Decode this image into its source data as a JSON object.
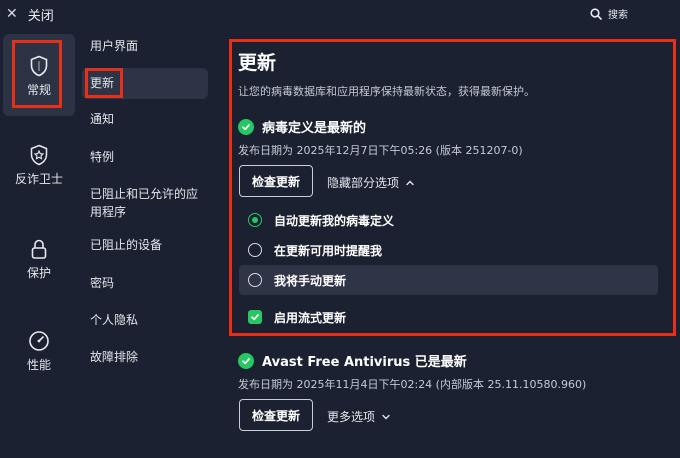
{
  "window": {
    "close_label": "关闭",
    "search_label": "搜索"
  },
  "iconbar": [
    {
      "label": "常规",
      "icon": "shield-icon",
      "active": true
    },
    {
      "label": "反诈卫士",
      "icon": "shield-star-icon"
    },
    {
      "label": "保护",
      "icon": "lock-icon"
    },
    {
      "label": "性能",
      "icon": "speedometer-icon"
    }
  ],
  "submenu": [
    {
      "label": "用户界面"
    },
    {
      "label": "更新",
      "active": true
    },
    {
      "label": "通知"
    },
    {
      "label": "特例"
    },
    {
      "label": "已阻止和已允许的应用程序"
    },
    {
      "label": "已阻止的设备"
    },
    {
      "label": "密码"
    },
    {
      "label": "个人隐私"
    },
    {
      "label": "故障排除"
    }
  ],
  "content": {
    "title": "更新",
    "description": "让您的病毒数据库和应用程序保持最新状态，获得最新保护。",
    "virus_defs": {
      "status": "病毒定义是最新的",
      "meta": "发布日期为 2025年12月7日下午05:26 (版本 251207-0)",
      "check_button": "检查更新",
      "toggle_link": "隐藏部分选项",
      "options": [
        {
          "label": "自动更新我的病毒定义",
          "checked": true
        },
        {
          "label": "在更新可用时提醒我",
          "checked": false
        },
        {
          "label": "我将手动更新",
          "checked": false
        }
      ],
      "streaming_label": "启用流式更新",
      "streaming_checked": true
    },
    "app": {
      "status": "Avast Free Antivirus 已是最新",
      "meta": "发布日期为 2025年11月4日下午02:24 (内部版本 25.11.10580.960)",
      "check_button": "检查更新",
      "more_link": "更多选项"
    }
  },
  "colors": {
    "background": "#1b2130",
    "accent_green": "#27c763",
    "highlight_red": "#e7301a",
    "selected_bg": "#2d3446"
  }
}
